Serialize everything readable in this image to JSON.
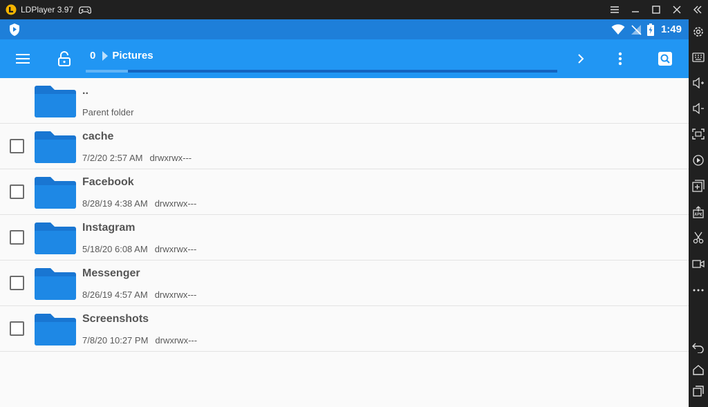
{
  "window": {
    "title": "LDPlayer 3.97"
  },
  "status_bar": {
    "time": "1:49"
  },
  "toolbar": {
    "breadcrumb_root": "0",
    "breadcrumb_current": "Pictures",
    "scroll_progress": 0.09
  },
  "parent_item": {
    "name": "..",
    "subtitle": "Parent folder"
  },
  "files": [
    {
      "name": "cache",
      "date": "7/2/20 2:57 AM",
      "perms": "drwxrwx---"
    },
    {
      "name": "Facebook",
      "date": "8/28/19 4:38 AM",
      "perms": "drwxrwx---"
    },
    {
      "name": "Instagram",
      "date": "5/18/20 6:08 AM",
      "perms": "drwxrwx---"
    },
    {
      "name": "Messenger",
      "date": "8/26/19 4:57 AM",
      "perms": "drwxrwx---"
    },
    {
      "name": "Screenshots",
      "date": "7/8/20 10:27 PM",
      "perms": "drwxrwx---"
    }
  ],
  "colors": {
    "status_bar": "#1e7fd9",
    "toolbar": "#2196f3",
    "folder": "#1976d2",
    "background": "#fafafa"
  }
}
